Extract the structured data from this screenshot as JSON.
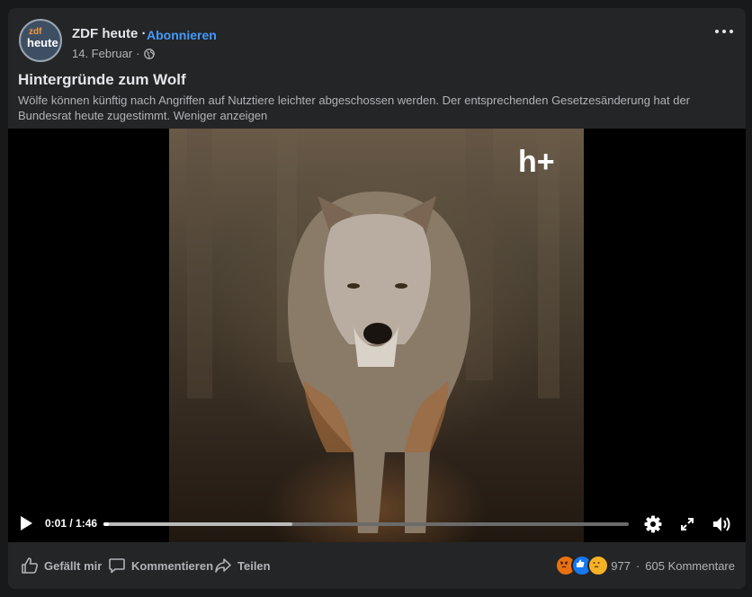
{
  "post": {
    "page_name": "ZDF heute",
    "page_name_sep": "·",
    "subscribe": "Abonnieren",
    "date": "14. Februar",
    "meta_sep": "·",
    "avatar_line1": "zdf",
    "avatar_line2": "heute",
    "title": "Hintergründe zum Wolf",
    "description": "Wölfe können künftig nach Angriffen auf Nutztiere leichter abgeschossen werden. Der entsprechenden Gesetzesänderung hat der Bundesrat heute zugestimmt. Weniger anzeigen"
  },
  "video": {
    "watermark": "h+",
    "time": "0:01 / 1:46",
    "progress_fraction": 0.01,
    "buffered_fraction": 0.36
  },
  "actions": {
    "like": "Gefällt mir",
    "comment": "Kommentieren",
    "share": "Teilen"
  },
  "reactions": {
    "count": "977",
    "sep": "·",
    "comments": "605 Kommentare",
    "icons": [
      "angry-reaction-icon",
      "like-reaction-icon",
      "sad-reaction-icon"
    ]
  },
  "colors": {
    "background": "#18191a",
    "card": "#242526",
    "accent": "#4599ff",
    "text_primary": "#e4e6eb",
    "text_secondary": "#b0b3b8"
  }
}
